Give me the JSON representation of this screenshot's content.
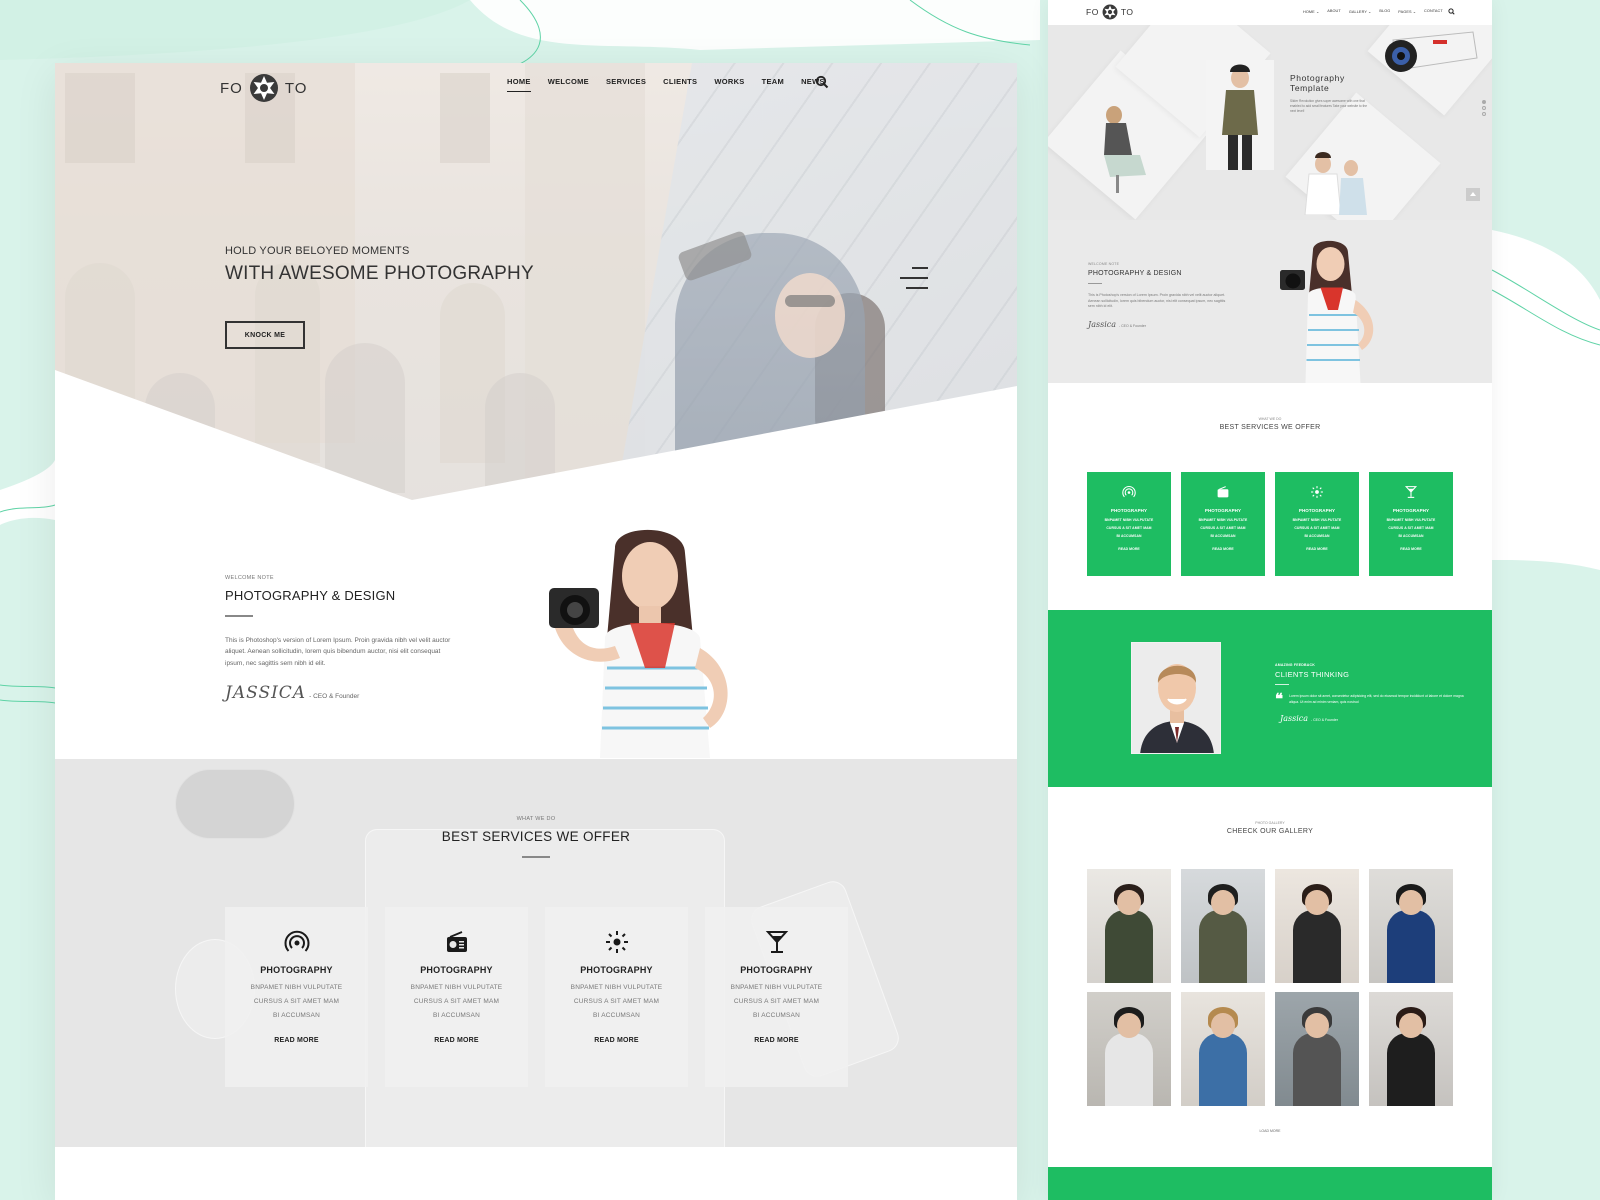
{
  "colors": {
    "accent": "#1ebd62",
    "mint_bg": "#d9f3ea",
    "service_bg": "#e6e6e6"
  },
  "left_page": {
    "logo": {
      "left": "FO",
      "right": "TO",
      "icon": "camera-aperture-icon"
    },
    "nav": {
      "items": [
        {
          "label": "HOME",
          "active": true
        },
        {
          "label": "WELCOME",
          "active": false
        },
        {
          "label": "SERVICES",
          "active": false
        },
        {
          "label": "CLIENTS",
          "active": false
        },
        {
          "label": "WORKS",
          "active": false
        },
        {
          "label": "TEAM",
          "active": false
        },
        {
          "label": "NEWS",
          "active": false
        }
      ],
      "search_icon": "search-icon"
    },
    "hero": {
      "subtitle": "HOLD YOUR BELOYED MOMENTS",
      "title": "WITH AWESOME PHOTOGRAPHY",
      "button": "KNOCK ME",
      "menu_icon": "hamburger-menu-icon"
    },
    "welcome": {
      "eyebrow": "WELCOME NOTE",
      "title": "PHOTOGRAPHY & DESIGN",
      "body": "This is Photoshop's version of Lorem Ipsum. Proin gravida nibh vel velit auctor aliquet. Aenean sollicitudin, lorem quis bibendum auctor, nisi elit consequat ipsum, nec sagittis sem nibh id elit.",
      "signature": "JASSICA",
      "role": "- CEO & Founder"
    },
    "services": {
      "eyebrow": "WHAT WE DO",
      "title": "BEST SERVICES WE OFFER",
      "cards": [
        {
          "icon": "signal-broadcast-icon",
          "title": "PHOTOGRAPHY",
          "line1": "BNPAMET NIBH VULPUTATE",
          "line2": "CURSUS A SIT AMET MAM",
          "line3": "BI ACCUMSAN",
          "link": "READ MORE"
        },
        {
          "icon": "radio-icon",
          "title": "PHOTOGRAPHY",
          "line1": "BNPAMET NIBH VULPUTATE",
          "line2": "CURSUS A SIT AMET MAM",
          "line3": "BI ACCUMSAN",
          "link": "READ MORE"
        },
        {
          "icon": "sun-brightness-icon",
          "title": "PHOTOGRAPHY",
          "line1": "BNPAMET NIBH VULPUTATE",
          "line2": "CURSUS A SIT AMET MAM",
          "line3": "BI ACCUMSAN",
          "link": "READ MORE"
        },
        {
          "icon": "cocktail-glass-icon",
          "title": "PHOTOGRAPHY",
          "line1": "BNPAMET NIBH VULPUTATE",
          "line2": "CURSUS A SIT AMET MAM",
          "line3": "BI ACCUMSAN",
          "link": "READ MORE"
        }
      ]
    }
  },
  "right_page": {
    "logo": {
      "left": "FO",
      "right": "TO"
    },
    "nav": {
      "items": [
        {
          "label": "HOME ⌄"
        },
        {
          "label": "ABOUT"
        },
        {
          "label": "GALLERY ⌄"
        },
        {
          "label": "BLOG"
        },
        {
          "label": "PAGES ⌄"
        },
        {
          "label": "CONTACT"
        }
      ]
    },
    "hero": {
      "title_line1": "Photography",
      "title_line2": "Template",
      "body": "Slider Revolution gives super awesome with one that enabled to add small features Take your website to the next level!",
      "slider_dots": 3,
      "active_dot": 1
    },
    "welcome": {
      "eyebrow": "WELCOME NOTE",
      "title": "PHOTOGRAPHY & DESIGN",
      "body": "This is Photoshop's version of Lorem Ipsum. Proin gravida nibh vel velit auctor aliquet. Aenean sollicitudin, lorem quis bibendum auctor, nisi elit consequat ipsum, nec sagittis sem nibh id elit.",
      "signature": "Jassica",
      "role": "- CEO & Founder"
    },
    "services": {
      "eyebrow": "WHAT WE DO",
      "title": "BEST SERVICES WE OFFER",
      "cards": [
        {
          "icon": "signal-broadcast-icon",
          "title": "PHOTOGRAPHY",
          "line1": "BNPAMET NIBH VULPUTATE",
          "line2": "CURSUS A SIT AMET MAM",
          "line3": "BI ACCUMSAN",
          "link": "READ MORE"
        },
        {
          "icon": "radio-icon",
          "title": "PHOTOGRAPHY",
          "line1": "BNPAMET NIBH VULPUTATE",
          "line2": "CURSUS A SIT AMET MAM",
          "line3": "BI ACCUMSAN",
          "link": "READ MORE"
        },
        {
          "icon": "sun-brightness-icon",
          "title": "PHOTOGRAPHY",
          "line1": "BNPAMET NIBH VULPUTATE",
          "line2": "CURSUS A SIT AMET MAM",
          "line3": "BI ACCUMSAN",
          "link": "READ MORE"
        },
        {
          "icon": "cocktail-glass-icon",
          "title": "PHOTOGRAPHY",
          "line1": "BNPAMET NIBH VULPUTATE",
          "line2": "CURSUS A SIT AMET MAM",
          "line3": "BI ACCUMSAN",
          "link": "READ MORE"
        }
      ]
    },
    "clients": {
      "eyebrow": "AMAZING FEEDBACK",
      "title": "CLIENTS THINKING",
      "quote": "Lorem ipsum dolor sit amet, consectetur adipisicing elit, sed do eiusmod tempor incididunt ut labore et dolore magna aliqua. Ut enim ad minim veniam, quis nostrud",
      "signature": "Jassica",
      "role": "- CEO & Founder"
    },
    "gallery": {
      "eyebrow": "PHOTO GALLERY",
      "title": "CHEECK OUR GALLERY",
      "load_more": "LOAD MORE",
      "items": [
        {
          "alt": "woman-sunglasses-green-coat"
        },
        {
          "alt": "man-camera-street"
        },
        {
          "alt": "woman-mirrored-sunglasses"
        },
        {
          "alt": "woman-blue-coat"
        },
        {
          "alt": "bearded-man-striped-shirt"
        },
        {
          "alt": "woman-hat-denim-dress"
        },
        {
          "alt": "man-cap-camera"
        },
        {
          "alt": "woman-black-dress-handbag"
        }
      ]
    }
  }
}
